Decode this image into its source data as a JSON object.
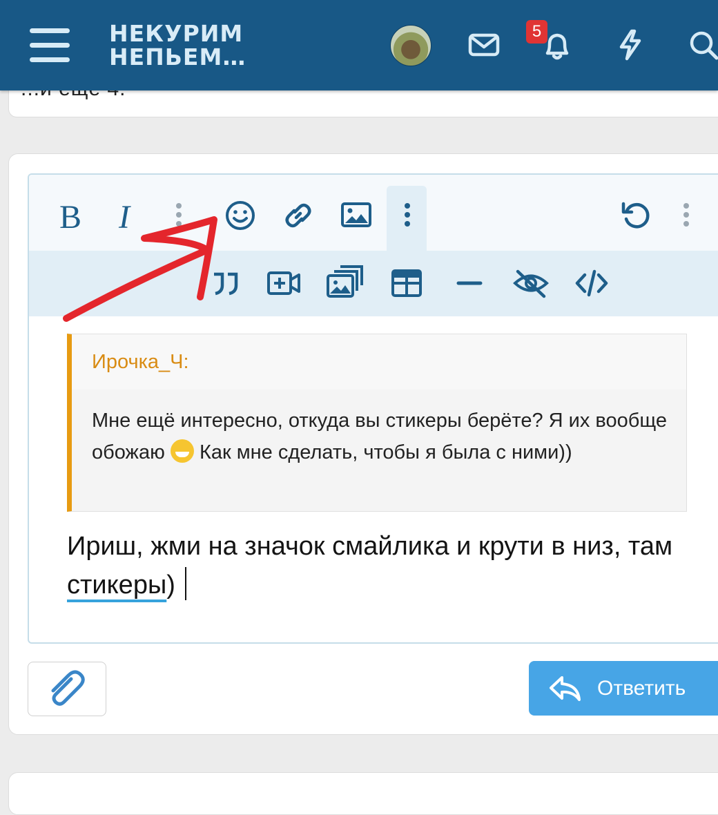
{
  "header": {
    "logo_line1": "НЕКУРИМ",
    "logo_line2": "НЕПЬЕМ…",
    "notification_count": "5",
    "colors": {
      "background": "#185886",
      "icon": "#d7ebf6",
      "badge": "#e03434"
    }
  },
  "previous_post": {
    "text": "...и ещё 4."
  },
  "editor": {
    "toolbar_primary": [
      "bold-icon",
      "italic-icon",
      "more-options-icon",
      "smiley-icon",
      "link-icon",
      "image-icon",
      "more-active-icon",
      "undo-icon",
      "overflow-icon"
    ],
    "toolbar_secondary": [
      "quote-icon",
      "video-icon",
      "gallery-icon",
      "table-icon",
      "horizontal-rule-icon",
      "spoiler-icon",
      "code-icon"
    ],
    "bold_label": "B",
    "italic_label": "I",
    "quote": {
      "author": "Ирочка_Ч:",
      "text_part1": "Мне ещё интересно, откуда вы стикеры берёте? Я их вообще обожаю",
      "text_part2": "Как мне сделать, чтобы я была с ними))"
    },
    "reply_text_part1": "Ириш, жми на значок смайлика и крути в низ, там",
    "reply_text_underlined": "стикеры",
    "reply_text_part2": ")"
  },
  "actions": {
    "reply_label": "Ответить"
  },
  "colors": {
    "accent": "#47a5e6",
    "quote_border": "#e79b12",
    "annotation_arrow": "#e4262c"
  }
}
